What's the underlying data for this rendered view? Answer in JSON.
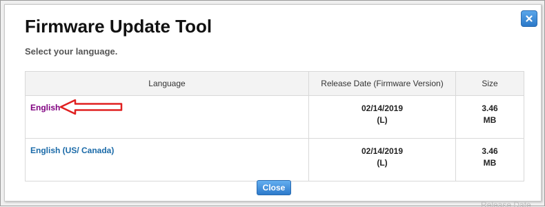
{
  "dialog": {
    "title": "Firmware Update Tool",
    "subtitle": "Select your language.",
    "close_icon": "close-x-icon",
    "close_button_label": "Close"
  },
  "table": {
    "headers": [
      "Language",
      "Release Date (Firmware Version)",
      "Size"
    ],
    "rows": [
      {
        "language": "English",
        "date": "02/14/2019",
        "version": "(L)",
        "size_value": "3.46",
        "size_unit": "MB",
        "link_color": "#800080"
      },
      {
        "language": "English (US/ Canada)",
        "date": "02/14/2019",
        "version": "(L)",
        "size_value": "3.46",
        "size_unit": "MB",
        "link_color": "#1a6aa8"
      }
    ]
  },
  "annotation": {
    "icon": "red-arrow-left-icon",
    "color": "#e02020"
  },
  "background_text": "Release Date",
  "colors": {
    "accent_blue": "#2b78c8",
    "visited_link": "#800080",
    "link": "#1a6aa8"
  }
}
